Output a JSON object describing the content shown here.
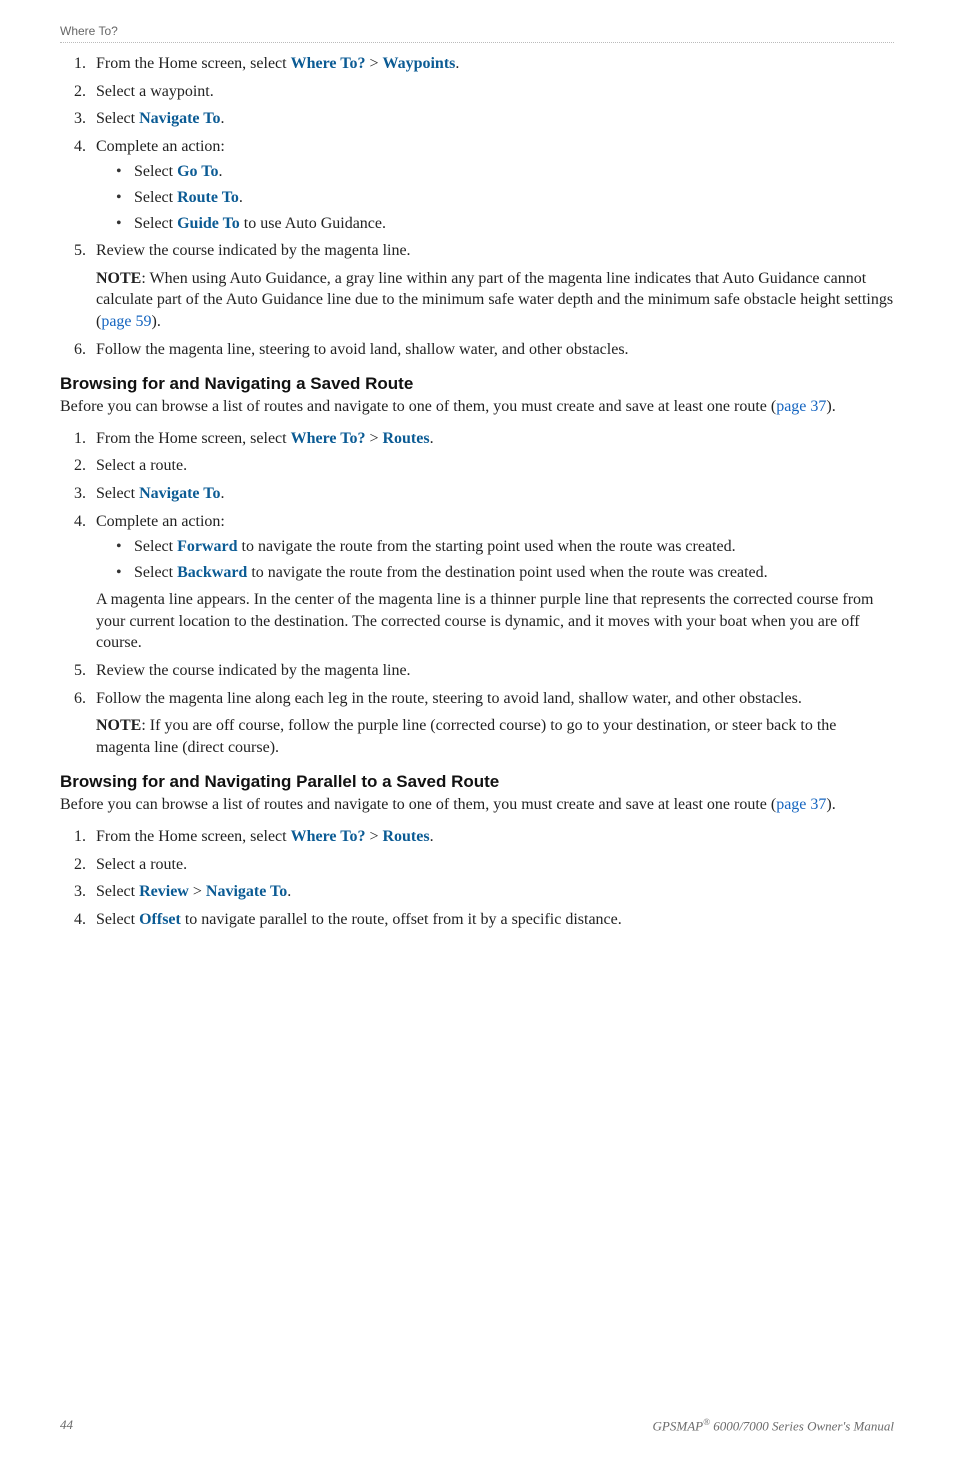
{
  "runningHead": "Where To?",
  "sec1": {
    "s1_pre": "From the Home screen, select ",
    "s1_a": "Where To?",
    "s1_gt": " > ",
    "s1_b": "Waypoints",
    "s1_post": ".",
    "s2": "Select a waypoint.",
    "s3_pre": "Select ",
    "s3_a": "Navigate To",
    "s3_post": ".",
    "s4": "Complete an action:",
    "s4a_pre": "Select ",
    "s4a_a": "Go To",
    "s4a_post": ".",
    "s4b_pre": "Select ",
    "s4b_a": "Route To",
    "s4b_post": ".",
    "s4c_pre": "Select ",
    "s4c_a": "Guide To",
    "s4c_post": " to use Auto Guidance.",
    "s5": "Review the course indicated by the magenta line.",
    "s5_note_label": "NOTE",
    "s5_note_a": ": When using Auto Guidance, a gray line within any part of the magenta line indicates that Auto Guidance cannot calculate part of the Auto Guidance line due to the minimum safe water depth and the minimum safe obstacle height settings (",
    "s5_note_link": "page 59",
    "s5_note_b": ").",
    "s6": "Follow the magenta line, steering to avoid land, shallow water, and other obstacles."
  },
  "sec2": {
    "head": "Browsing for and Navigating a Saved Route",
    "intro_a": "Before you can browse a list of routes and navigate to one of them, you must create and save at least one route (",
    "intro_link": "page 37",
    "intro_b": ").",
    "s1_pre": "From the Home screen, select ",
    "s1_a": "Where To?",
    "s1_gt": " > ",
    "s1_b": "Routes",
    "s1_post": ".",
    "s2": "Select a route.",
    "s3_pre": "Select ",
    "s3_a": "Navigate To",
    "s3_post": ".",
    "s4": "Complete an action:",
    "s4a_pre": "Select ",
    "s4a_a": "Forward",
    "s4a_post": " to navigate the route from the starting point used when the route was created.",
    "s4b_pre": "Select ",
    "s4b_a": "Backward",
    "s4b_post": " to navigate the route from the destination point used when the route was created.",
    "s4_para": "A magenta line appears. In the center of the magenta line is a thinner purple line that represents the corrected course from your current location to the destination. The corrected course is dynamic, and it moves with your boat when you are off course.",
    "s5": "Review the course indicated by the magenta line.",
    "s6": "Follow the magenta line along each leg in the route, steering to avoid land, shallow water, and other obstacles.",
    "s6_note_label": "NOTE",
    "s6_note": ": If you are off course, follow the purple line (corrected course) to go to your destination, or steer back to the magenta line (direct course)."
  },
  "sec3": {
    "head": "Browsing for and Navigating Parallel to a Saved Route",
    "intro_a": "Before you can browse a list of routes and navigate to one of them, you must create and save at least one route (",
    "intro_link": "page 37",
    "intro_b": ").",
    "s1_pre": "From the Home screen, select ",
    "s1_a": "Where To?",
    "s1_gt": " > ",
    "s1_b": "Routes",
    "s1_post": ".",
    "s2": "Select a route.",
    "s3_pre": "Select ",
    "s3_a": "Review",
    "s3_gt": " > ",
    "s3_b": "Navigate To",
    "s3_post": ".",
    "s4_pre": "Select ",
    "s4_a": "Offset",
    "s4_post": " to navigate parallel to the route, offset from it by a specific distance."
  },
  "footer": {
    "page": "44",
    "manual_a": "GPSMAP",
    "manual_sup": "®",
    "manual_b": " 6000/7000 Series Owner's Manual"
  }
}
